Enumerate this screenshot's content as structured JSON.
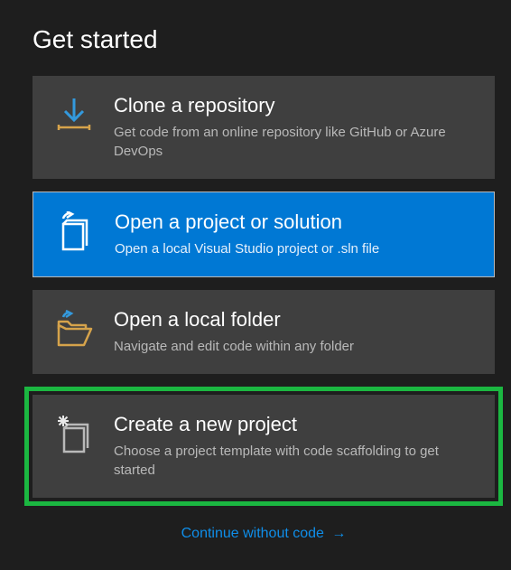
{
  "heading": "Get started",
  "cards": {
    "clone": {
      "title": "Clone a repository",
      "desc": "Get code from an online repository like GitHub or Azure DevOps"
    },
    "open_project": {
      "title": "Open a project or solution",
      "desc": "Open a local Visual Studio project or .sln file"
    },
    "open_folder": {
      "title": "Open a local folder",
      "desc": "Navigate and edit code within any folder"
    },
    "new_project": {
      "title": "Create a new project",
      "desc": "Choose a project template with code scaffolding to get started"
    }
  },
  "footer": {
    "label": "Continue without code",
    "arrow": "→"
  }
}
